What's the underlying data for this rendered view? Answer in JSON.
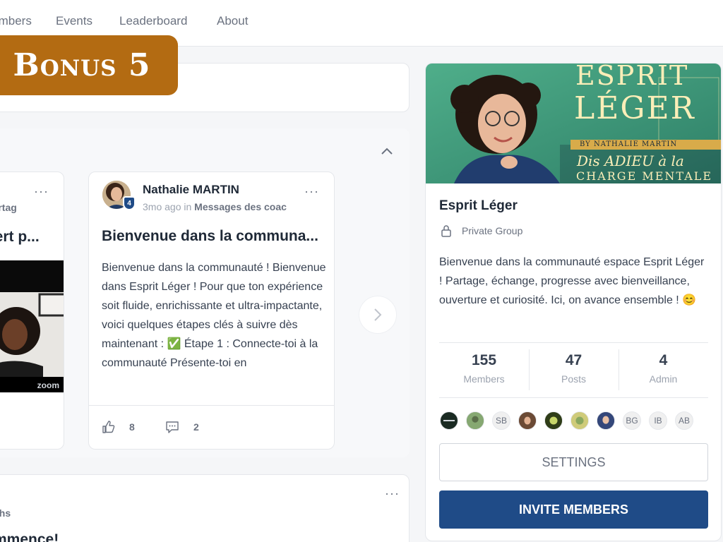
{
  "nav": {
    "items": [
      "Members",
      "Events",
      "Leaderboard",
      "About"
    ]
  },
  "bonus": {
    "label": "Bonus 5"
  },
  "carousel": {
    "left_card": {
      "meta": "partag",
      "title": "vert p...",
      "video_brand": "zoom"
    },
    "main_card": {
      "author": "Nathalie MARTIN",
      "badge": "4",
      "time": "3mo ago in ",
      "space": "Messages des coac",
      "title": "Bienvenue dans la communa...",
      "body": "Bienvenue dans la communauté ! Bienvenue dans Esprit Léger ! Pour que ton expérience soit fluide, enrichissante et ultra-impactante, voici quelques étapes clés à suivre dès maintenant : ✅ Étape 1 : Connecte-toi à la communauté Présente-toi en",
      "likes": "8",
      "comments": "2"
    }
  },
  "bottom_card": {
    "meta": "chs",
    "title": "mmence!"
  },
  "group": {
    "banner": {
      "line1": "ESPRIT",
      "line2": "LÉGER",
      "byline": "BY NATHALIE MARTIN",
      "tag1": "Dis ADIEU à la",
      "tag2": "CHARGE MENTALE"
    },
    "name": "Esprit Léger",
    "privacy": "Private Group",
    "description": "Bienvenue dans la communauté espace Esprit Léger ! Partage, échange, progresse avec bienveillance, ouverture et curiosité. Ici, on avance ensemble ! 😊",
    "stats": [
      {
        "value": "155",
        "label": "Members"
      },
      {
        "value": "47",
        "label": "Posts"
      },
      {
        "value": "4",
        "label": "Admin"
      }
    ],
    "member_initials": [
      "SB",
      "BG",
      "IB",
      "AB"
    ],
    "settings_label": "SETTINGS",
    "invite_label": "INVITE MEMBERS"
  },
  "colors": {
    "accent": "#1f4b87",
    "bonus": "#b36b12",
    "banner": "#3f9a7a",
    "check": "#22c55e"
  }
}
